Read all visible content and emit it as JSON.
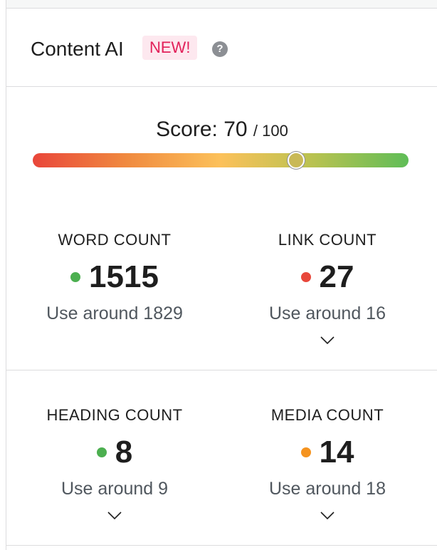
{
  "header": {
    "title": "Content AI",
    "badge": "NEW!",
    "help_glyph": "?"
  },
  "score": {
    "label": "Score:",
    "value": "70",
    "max": "/ 100",
    "fraction": 0.7
  },
  "metrics": [
    {
      "label": "WORD COUNT",
      "value": "1515",
      "hint": "Use around 1829",
      "status_color": "#4caf50",
      "expandable": false
    },
    {
      "label": "LINK COUNT",
      "value": "27",
      "hint": "Use around 16",
      "status_color": "#e8473b",
      "expandable": true
    },
    {
      "label": "HEADING COUNT",
      "value": "8",
      "hint": "Use around 9",
      "status_color": "#4caf50",
      "expandable": true
    },
    {
      "label": "MEDIA COUNT",
      "value": "14",
      "hint": "Use around 18",
      "status_color": "#f5931f",
      "expandable": true
    }
  ]
}
